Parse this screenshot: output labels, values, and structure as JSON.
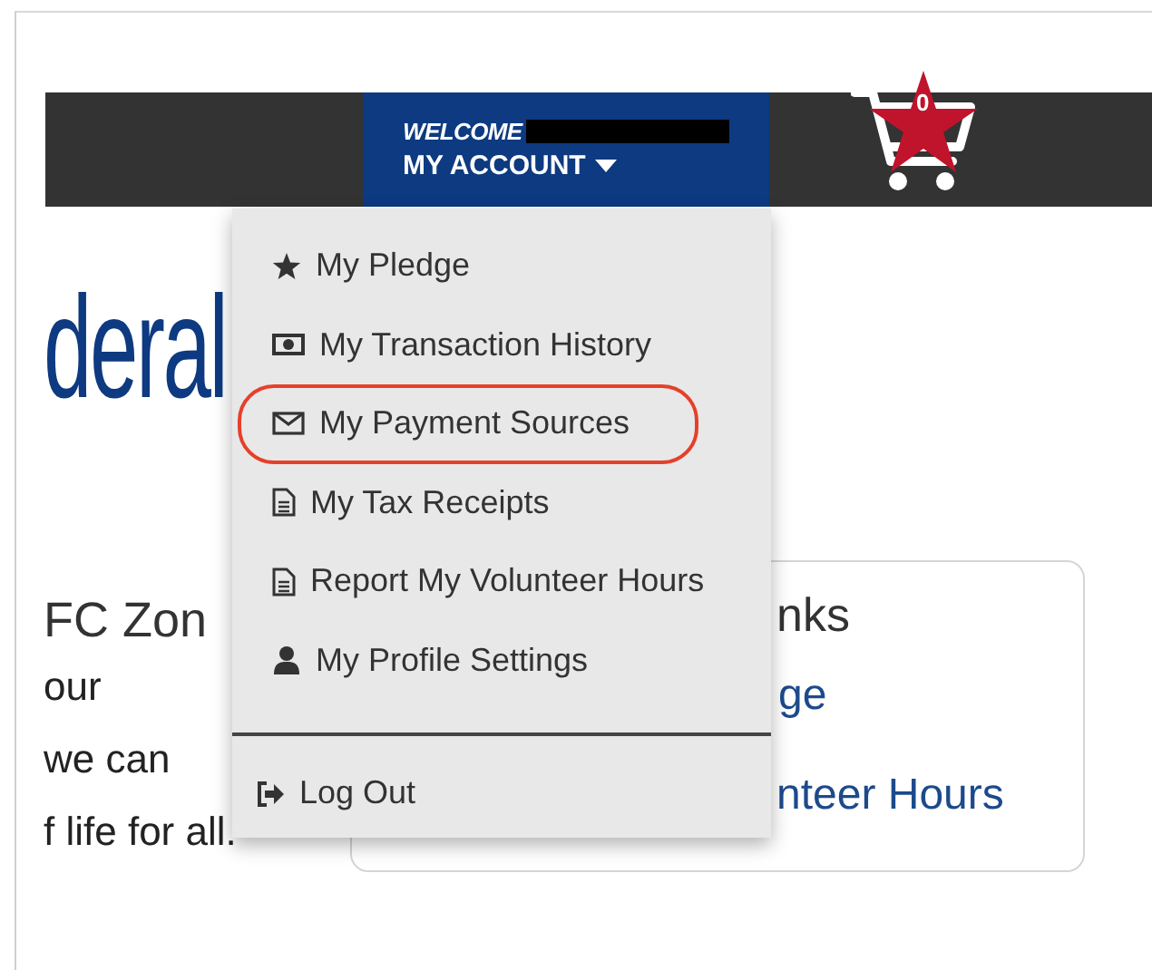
{
  "nav": {
    "welcome": "WELCOME",
    "account_label": "MY ACCOUNT",
    "cart_count": "0"
  },
  "account_menu": {
    "expanded": true,
    "items": [
      {
        "label": "My Pledge",
        "kind": "star",
        "circled": false
      },
      {
        "label": "My Transaction History",
        "kind": "money",
        "circled": false
      },
      {
        "label": "My Payment Sources",
        "kind": "envelope",
        "circled": true
      },
      {
        "label": "My Tax Receipts",
        "kind": "document",
        "circled": false
      },
      {
        "label": "Report My Volunteer Hours",
        "kind": "document",
        "circled": false
      },
      {
        "label": "My Profile Settings",
        "kind": "user",
        "circled": false
      }
    ],
    "logout": {
      "label": "Log Out"
    }
  },
  "page": {
    "logo_text": "deral",
    "section_title": "FC Zon",
    "body_lines": [
      "our",
      "we can",
      "f life for all."
    ]
  },
  "links_card": {
    "title": "nks",
    "links": [
      "ge",
      "nteer Hours"
    ]
  }
}
